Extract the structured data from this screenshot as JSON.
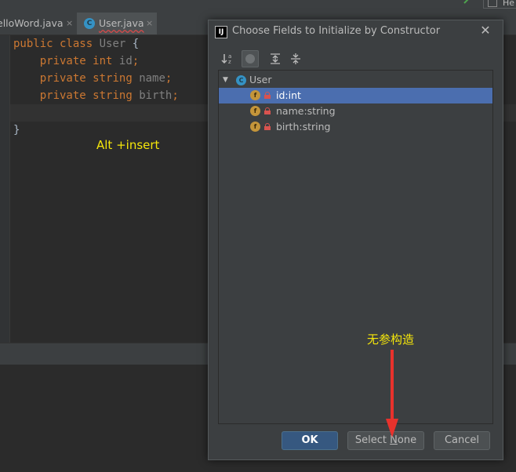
{
  "tabs": [
    {
      "label": "elloWord.java",
      "close": "×"
    },
    {
      "label": "User.java",
      "icon": "class-icon",
      "icon_text": "C",
      "close": "×"
    }
  ],
  "toolbar": {
    "run_config_label": "He"
  },
  "editor": {
    "lines": [
      {
        "kw": "public class",
        "name": "User",
        "rest": " {"
      },
      {
        "kw": "private",
        "type": "int",
        "name": "id",
        "rest": ";"
      },
      {
        "kw": "private",
        "type": "string",
        "name": "name",
        "rest": ";"
      },
      {
        "kw": "private",
        "type": "string",
        "name": "birth",
        "rest": ";"
      },
      {
        "text": "}"
      }
    ]
  },
  "annotations": {
    "shortcut": "Alt +insert",
    "no_arg_constructor": "无参构造"
  },
  "dialog": {
    "icon_text": "IJ",
    "title": "Choose Fields to Initialize by Constructor",
    "close": "✕",
    "toolbar_icons": [
      "sort-alpha-icon",
      "show-fields-icon",
      "expand-all-icon",
      "collapse-all-icon"
    ],
    "tree": {
      "root": {
        "label": "User",
        "icon_text": "C",
        "expanded": true
      },
      "items": [
        {
          "label": "id:int",
          "icon_text": "f",
          "selected": true
        },
        {
          "label": "name:string",
          "icon_text": "f",
          "selected": false
        },
        {
          "label": "birth:string",
          "icon_text": "f",
          "selected": false
        }
      ]
    },
    "buttons": {
      "ok": "OK",
      "select_none_prefix": "Select ",
      "select_none_mnemonic": "N",
      "select_none_suffix": "one",
      "cancel": "Cancel"
    }
  },
  "colors": {
    "accent_selected": "#4b6eaf",
    "ok_button": "#365880",
    "annotation": "#f5e60a",
    "arrow": "#e8322c"
  }
}
